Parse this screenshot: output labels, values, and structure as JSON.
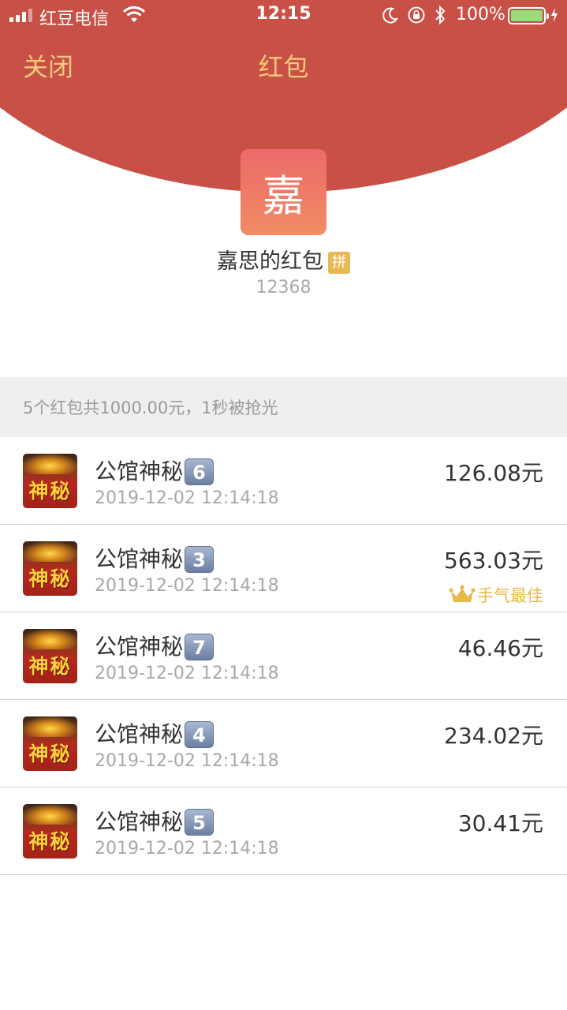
{
  "status_bar": {
    "carrier": "红豆电信",
    "time": "12:15",
    "battery_percent": "100%"
  },
  "nav": {
    "close_label": "关闭",
    "title": "红包"
  },
  "sender": {
    "avatar_char": "嘉",
    "name": "嘉思的红包",
    "badge": "拼",
    "code": "12368"
  },
  "summary": "5个红包共1000.00元，1秒被抢光",
  "claims": [
    {
      "name": "公馆神秘",
      "badge_num": "6",
      "time": "2019-12-02 12:14:18",
      "amount": "126.08元",
      "best_label": "",
      "avatar_text": "神秘"
    },
    {
      "name": "公馆神秘",
      "badge_num": "3",
      "time": "2019-12-02 12:14:18",
      "amount": "563.03元",
      "best_label": "手气最佳",
      "avatar_text": "神秘"
    },
    {
      "name": "公馆神秘",
      "badge_num": "7",
      "time": "2019-12-02 12:14:18",
      "amount": "46.46元",
      "best_label": "",
      "avatar_text": "神秘"
    },
    {
      "name": "公馆神秘",
      "badge_num": "4",
      "time": "2019-12-02 12:14:18",
      "amount": "234.02元",
      "best_label": "",
      "avatar_text": "神秘"
    },
    {
      "name": "公馆神秘",
      "badge_num": "5",
      "time": "2019-12-02 12:14:18",
      "amount": "30.41元",
      "best_label": "",
      "avatar_text": "神秘"
    }
  ],
  "colors": {
    "header_red": "#c85046",
    "nav_gold": "#f4c97a",
    "best_gold": "#e8b84a"
  }
}
